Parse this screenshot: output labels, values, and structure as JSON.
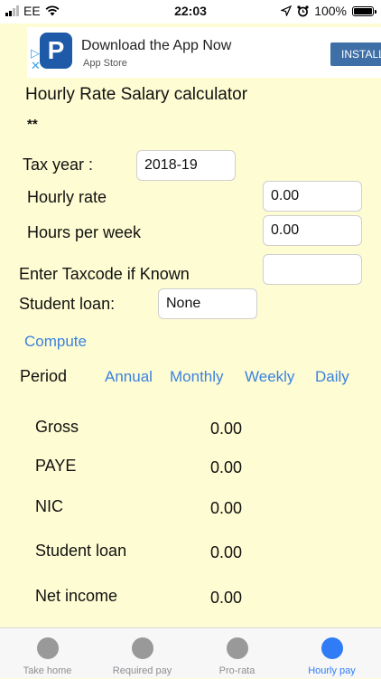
{
  "status_bar": {
    "carrier": "EE",
    "time": "22:03",
    "battery": "100%"
  },
  "ad": {
    "title": "Download the App Now",
    "subtitle": "App Store",
    "install": "INSTALL",
    "logo_letter": "P"
  },
  "page": {
    "title": "Hourly Rate Salary calculator",
    "subtitle": "**"
  },
  "form": {
    "tax_year_label": "Tax year :",
    "tax_year_value": "2018-19",
    "hourly_rate_label": "Hourly rate",
    "hourly_rate_value": "0.00",
    "hours_per_week_label": "Hours per week",
    "hours_per_week_value": "0.00",
    "taxcode_label": "Enter Taxcode if Known",
    "taxcode_value": "",
    "student_loan_label": "Student loan:",
    "student_loan_value": "None",
    "compute_label": "Compute"
  },
  "period": {
    "label": "Period",
    "options": [
      "Annual",
      "Monthly",
      "Weekly",
      "Daily"
    ]
  },
  "results": [
    {
      "label": "Gross",
      "value": "0.00"
    },
    {
      "label": "PAYE",
      "value": "0.00"
    },
    {
      "label": "NIC",
      "value": "0.00"
    },
    {
      "label": "Student loan",
      "value": "0.00"
    },
    {
      "label": "Net income",
      "value": "0.00"
    }
  ],
  "tabs": [
    {
      "label": "Take home",
      "active": false
    },
    {
      "label": "Required pay",
      "active": false
    },
    {
      "label": "Pro-rata",
      "active": false
    },
    {
      "label": "Hourly pay",
      "active": true
    }
  ],
  "colors": {
    "background": "#fefcd2",
    "accent": "#2f7cf6",
    "link": "#3b82e0"
  }
}
